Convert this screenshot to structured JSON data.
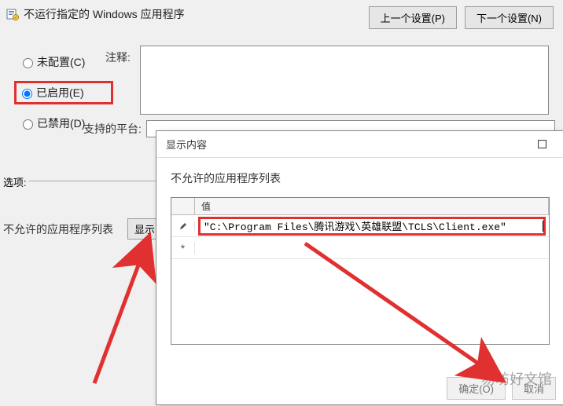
{
  "header": {
    "title": "不运行指定的 Windows 应用程序",
    "prev_btn": "上一个设置(P)",
    "next_btn": "下一个设置(N)"
  },
  "radios": {
    "unconfigured": "未配置(C)",
    "enabled": "已启用(E)",
    "disabled": "已禁用(D)"
  },
  "note_label": "注释:",
  "platform_label": "支持的平台:",
  "options_label": "选项:",
  "disallowed_label": "不允许的应用程序列表",
  "show_btn": "显示",
  "dialog": {
    "title": "显示内容",
    "subtitle": "不允许的应用程序列表",
    "col_value": "值",
    "row_value": "\"C:\\Program Files\\腾讯游戏\\英雄联盟\\TCLS\\Client.exe\"",
    "ok_btn": "确定(O)",
    "cancel_btn": "取消"
  },
  "watermark": "易坊好文馆"
}
